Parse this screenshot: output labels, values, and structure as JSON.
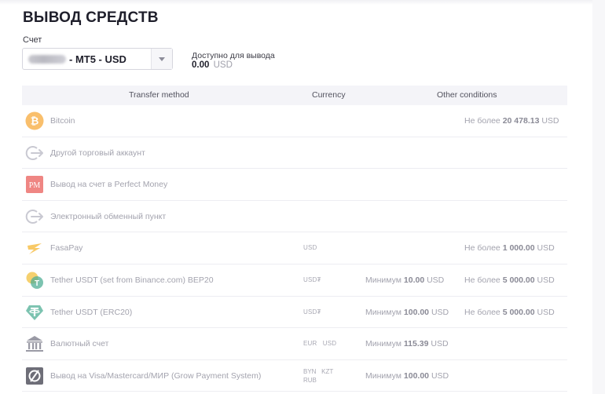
{
  "page": {
    "title": "ВЫВОД СРЕДСТВ"
  },
  "account": {
    "label": "Счет",
    "value": "- MT5 - USD"
  },
  "available": {
    "label": "Доступно для вывода",
    "amount": "0.00",
    "currency": "USD"
  },
  "table": {
    "headers": [
      "Transfer method",
      "Currency",
      "Other conditions"
    ],
    "rows": [
      {
        "icon": "bitcoin-icon",
        "name": "Bitcoin",
        "currency": "",
        "min_prefix": "",
        "min_value": "",
        "min_currency": "",
        "max_prefix": "Не более",
        "max_value": "20 478.13",
        "max_currency": "USD"
      },
      {
        "icon": "transfer-arrow-icon",
        "name": "Другой торговый аккаунт",
        "currency": "",
        "min_prefix": "",
        "min_value": "",
        "min_currency": "",
        "max_prefix": "",
        "max_value": "",
        "max_currency": ""
      },
      {
        "icon": "perfect-money-icon",
        "name": "Вывод на счет в Perfect Money",
        "currency": "",
        "min_prefix": "",
        "min_value": "",
        "min_currency": "",
        "max_prefix": "",
        "max_value": "",
        "max_currency": ""
      },
      {
        "icon": "transfer-arrow-icon",
        "name": "Электронный обменный пункт",
        "currency": "",
        "min_prefix": "",
        "min_value": "",
        "min_currency": "",
        "max_prefix": "",
        "max_value": "",
        "max_currency": ""
      },
      {
        "icon": "fasapay-icon",
        "name": "FasaPay",
        "currency": "USD",
        "min_prefix": "",
        "min_value": "",
        "min_currency": "",
        "max_prefix": "Не более",
        "max_value": "1 000.00",
        "max_currency": "USD"
      },
      {
        "icon": "tether-binance-icon",
        "name": "Tether USDT (set from Binance.com) BEP20",
        "currency": "USD₮",
        "min_prefix": "Минимум",
        "min_value": "10.00",
        "min_currency": "USD",
        "max_prefix": "Не более",
        "max_value": "5 000.00",
        "max_currency": "USD"
      },
      {
        "icon": "tether-icon",
        "name": "Tether USDT (ERC20)",
        "currency": "USD₮",
        "min_prefix": "Минимум",
        "min_value": "100.00",
        "min_currency": "USD",
        "max_prefix": "Не более",
        "max_value": "5 000.00",
        "max_currency": "USD"
      },
      {
        "icon": "bank-icon",
        "name": "Валютный счет",
        "currency": "EUR   USD",
        "min_prefix": "Минимум",
        "min_value": "115.39",
        "min_currency": "USD",
        "max_prefix": "",
        "max_value": "",
        "max_currency": ""
      },
      {
        "icon": "grow-payment-icon",
        "name": "Вывод на Visa/Mastercard/МИР (Grow Payment System)",
        "currency_line1": "BYN   KZT",
        "currency_line2": "RUB",
        "min_prefix": "Минимум",
        "min_value": "100.00",
        "min_currency": "USD",
        "max_prefix": "",
        "max_value": "",
        "max_currency": ""
      }
    ]
  },
  "colors": {
    "bitcoin": "#f7a93b",
    "tether": "#50af95",
    "perfect_money": "#e8534f",
    "fasapay": "#f6b733",
    "header_bg": "#f4f4f8"
  }
}
